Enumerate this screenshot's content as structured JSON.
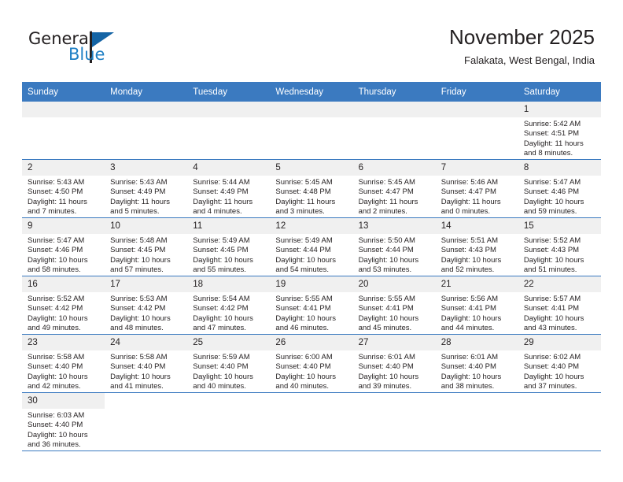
{
  "brand": {
    "name_part1": "General",
    "name_part2": "Blue",
    "flag_icon": "triangle-flag-icon",
    "accent_color": "#1e7fc4",
    "flag_color": "#1464a5"
  },
  "header": {
    "title": "November 2025",
    "subtitle": "Falakata, West Bengal, India"
  },
  "theme": {
    "header_row_color": "#3b7ac0",
    "daynum_band_color": "#f0f0f0",
    "grid_line_color": "#3b7ac0",
    "text_color": "#231f20"
  },
  "weekday_headers": [
    "Sunday",
    "Monday",
    "Tuesday",
    "Wednesday",
    "Thursday",
    "Friday",
    "Saturday"
  ],
  "weeks": [
    [
      {
        "empty": true
      },
      {
        "empty": true
      },
      {
        "empty": true
      },
      {
        "empty": true
      },
      {
        "empty": true
      },
      {
        "empty": true
      },
      {
        "day": "1",
        "sunrise": "Sunrise: 5:42 AM",
        "sunset": "Sunset: 4:51 PM",
        "daylight_line1": "Daylight: 11 hours",
        "daylight_line2": "and 8 minutes."
      }
    ],
    [
      {
        "day": "2",
        "sunrise": "Sunrise: 5:43 AM",
        "sunset": "Sunset: 4:50 PM",
        "daylight_line1": "Daylight: 11 hours",
        "daylight_line2": "and 7 minutes."
      },
      {
        "day": "3",
        "sunrise": "Sunrise: 5:43 AM",
        "sunset": "Sunset: 4:49 PM",
        "daylight_line1": "Daylight: 11 hours",
        "daylight_line2": "and 5 minutes."
      },
      {
        "day": "4",
        "sunrise": "Sunrise: 5:44 AM",
        "sunset": "Sunset: 4:49 PM",
        "daylight_line1": "Daylight: 11 hours",
        "daylight_line2": "and 4 minutes."
      },
      {
        "day": "5",
        "sunrise": "Sunrise: 5:45 AM",
        "sunset": "Sunset: 4:48 PM",
        "daylight_line1": "Daylight: 11 hours",
        "daylight_line2": "and 3 minutes."
      },
      {
        "day": "6",
        "sunrise": "Sunrise: 5:45 AM",
        "sunset": "Sunset: 4:47 PM",
        "daylight_line1": "Daylight: 11 hours",
        "daylight_line2": "and 2 minutes."
      },
      {
        "day": "7",
        "sunrise": "Sunrise: 5:46 AM",
        "sunset": "Sunset: 4:47 PM",
        "daylight_line1": "Daylight: 11 hours",
        "daylight_line2": "and 0 minutes."
      },
      {
        "day": "8",
        "sunrise": "Sunrise: 5:47 AM",
        "sunset": "Sunset: 4:46 PM",
        "daylight_line1": "Daylight: 10 hours",
        "daylight_line2": "and 59 minutes."
      }
    ],
    [
      {
        "day": "9",
        "sunrise": "Sunrise: 5:47 AM",
        "sunset": "Sunset: 4:46 PM",
        "daylight_line1": "Daylight: 10 hours",
        "daylight_line2": "and 58 minutes."
      },
      {
        "day": "10",
        "sunrise": "Sunrise: 5:48 AM",
        "sunset": "Sunset: 4:45 PM",
        "daylight_line1": "Daylight: 10 hours",
        "daylight_line2": "and 57 minutes."
      },
      {
        "day": "11",
        "sunrise": "Sunrise: 5:49 AM",
        "sunset": "Sunset: 4:45 PM",
        "daylight_line1": "Daylight: 10 hours",
        "daylight_line2": "and 55 minutes."
      },
      {
        "day": "12",
        "sunrise": "Sunrise: 5:49 AM",
        "sunset": "Sunset: 4:44 PM",
        "daylight_line1": "Daylight: 10 hours",
        "daylight_line2": "and 54 minutes."
      },
      {
        "day": "13",
        "sunrise": "Sunrise: 5:50 AM",
        "sunset": "Sunset: 4:44 PM",
        "daylight_line1": "Daylight: 10 hours",
        "daylight_line2": "and 53 minutes."
      },
      {
        "day": "14",
        "sunrise": "Sunrise: 5:51 AM",
        "sunset": "Sunset: 4:43 PM",
        "daylight_line1": "Daylight: 10 hours",
        "daylight_line2": "and 52 minutes."
      },
      {
        "day": "15",
        "sunrise": "Sunrise: 5:52 AM",
        "sunset": "Sunset: 4:43 PM",
        "daylight_line1": "Daylight: 10 hours",
        "daylight_line2": "and 51 minutes."
      }
    ],
    [
      {
        "day": "16",
        "sunrise": "Sunrise: 5:52 AM",
        "sunset": "Sunset: 4:42 PM",
        "daylight_line1": "Daylight: 10 hours",
        "daylight_line2": "and 49 minutes."
      },
      {
        "day": "17",
        "sunrise": "Sunrise: 5:53 AM",
        "sunset": "Sunset: 4:42 PM",
        "daylight_line1": "Daylight: 10 hours",
        "daylight_line2": "and 48 minutes."
      },
      {
        "day": "18",
        "sunrise": "Sunrise: 5:54 AM",
        "sunset": "Sunset: 4:42 PM",
        "daylight_line1": "Daylight: 10 hours",
        "daylight_line2": "and 47 minutes."
      },
      {
        "day": "19",
        "sunrise": "Sunrise: 5:55 AM",
        "sunset": "Sunset: 4:41 PM",
        "daylight_line1": "Daylight: 10 hours",
        "daylight_line2": "and 46 minutes."
      },
      {
        "day": "20",
        "sunrise": "Sunrise: 5:55 AM",
        "sunset": "Sunset: 4:41 PM",
        "daylight_line1": "Daylight: 10 hours",
        "daylight_line2": "and 45 minutes."
      },
      {
        "day": "21",
        "sunrise": "Sunrise: 5:56 AM",
        "sunset": "Sunset: 4:41 PM",
        "daylight_line1": "Daylight: 10 hours",
        "daylight_line2": "and 44 minutes."
      },
      {
        "day": "22",
        "sunrise": "Sunrise: 5:57 AM",
        "sunset": "Sunset: 4:41 PM",
        "daylight_line1": "Daylight: 10 hours",
        "daylight_line2": "and 43 minutes."
      }
    ],
    [
      {
        "day": "23",
        "sunrise": "Sunrise: 5:58 AM",
        "sunset": "Sunset: 4:40 PM",
        "daylight_line1": "Daylight: 10 hours",
        "daylight_line2": "and 42 minutes."
      },
      {
        "day": "24",
        "sunrise": "Sunrise: 5:58 AM",
        "sunset": "Sunset: 4:40 PM",
        "daylight_line1": "Daylight: 10 hours",
        "daylight_line2": "and 41 minutes."
      },
      {
        "day": "25",
        "sunrise": "Sunrise: 5:59 AM",
        "sunset": "Sunset: 4:40 PM",
        "daylight_line1": "Daylight: 10 hours",
        "daylight_line2": "and 40 minutes."
      },
      {
        "day": "26",
        "sunrise": "Sunrise: 6:00 AM",
        "sunset": "Sunset: 4:40 PM",
        "daylight_line1": "Daylight: 10 hours",
        "daylight_line2": "and 40 minutes."
      },
      {
        "day": "27",
        "sunrise": "Sunrise: 6:01 AM",
        "sunset": "Sunset: 4:40 PM",
        "daylight_line1": "Daylight: 10 hours",
        "daylight_line2": "and 39 minutes."
      },
      {
        "day": "28",
        "sunrise": "Sunrise: 6:01 AM",
        "sunset": "Sunset: 4:40 PM",
        "daylight_line1": "Daylight: 10 hours",
        "daylight_line2": "and 38 minutes."
      },
      {
        "day": "29",
        "sunrise": "Sunrise: 6:02 AM",
        "sunset": "Sunset: 4:40 PM",
        "daylight_line1": "Daylight: 10 hours",
        "daylight_line2": "and 37 minutes."
      }
    ],
    [
      {
        "day": "30",
        "sunrise": "Sunrise: 6:03 AM",
        "sunset": "Sunset: 4:40 PM",
        "daylight_line1": "Daylight: 10 hours",
        "daylight_line2": "and 36 minutes."
      },
      {
        "blank": true
      },
      {
        "blank": true
      },
      {
        "blank": true
      },
      {
        "blank": true
      },
      {
        "blank": true
      },
      {
        "blank": true
      }
    ]
  ]
}
